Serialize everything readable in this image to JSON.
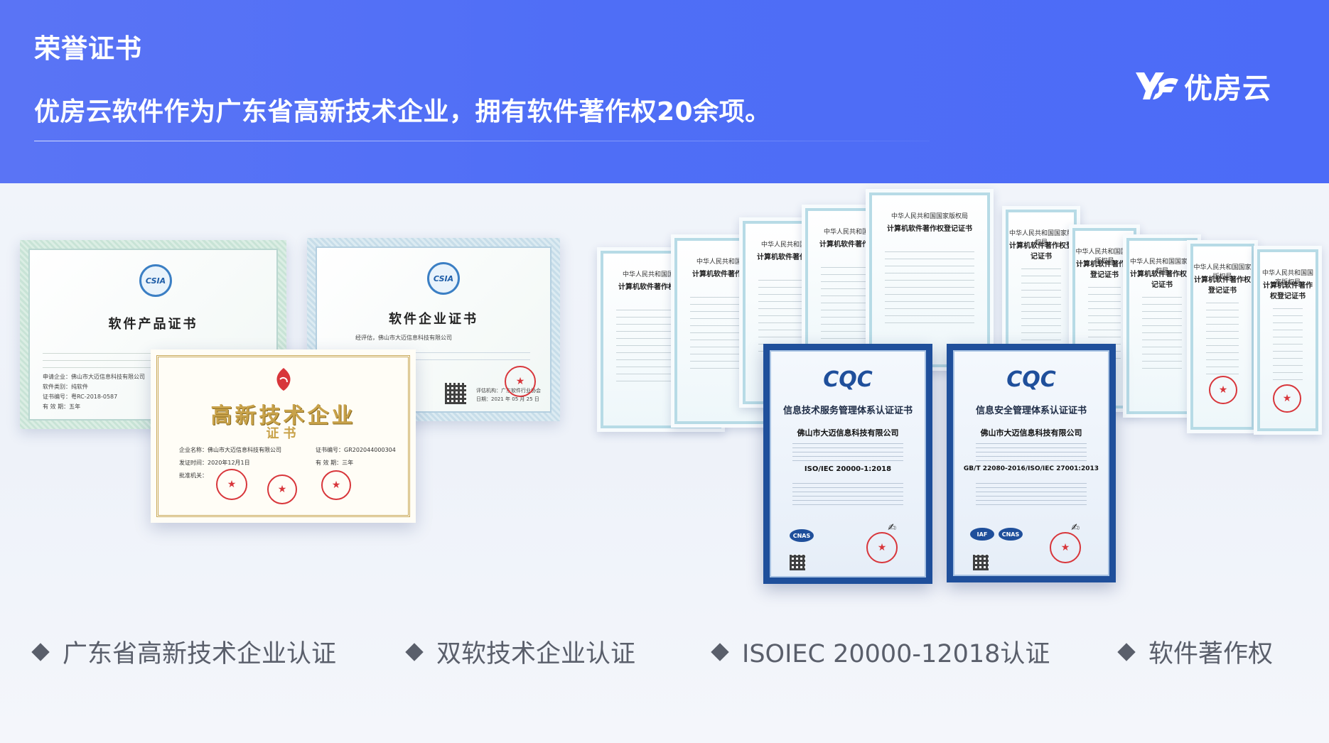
{
  "header": {
    "title": "荣誉证书",
    "subtitle": "优房云软件作为广东省高新技术企业，拥有软件著作权20余项。",
    "logo_text": "优房云",
    "logo_mark": "YF-logo-icon",
    "bg_color": "#4f6ef6"
  },
  "certificates": {
    "software_product": {
      "title": "软件产品证书",
      "badge": "CSIA",
      "company_line": "申请企业：佛山市大迈信息科技有限公司",
      "category_line": "软件类别：纯软件",
      "cert_no_line": "证书编号：粤RC-2018-0587",
      "validity_line": "有 效 期：五年"
    },
    "software_enterprise": {
      "title": "软件企业证书",
      "badge": "CSIA",
      "body_line": "经评估，佛山市大迈信息科技有限公司",
      "issuer_line": "评估机构：广东软件行业协会",
      "date_line": "日期：2021 年 05 月 25 日"
    },
    "gaoxin": {
      "title": "高新技术企业",
      "subtitle": "证书",
      "company_label": "企业名称：",
      "company_value": "佛山市大迈信息科技有限公司",
      "cert_no_label": "证书编号：",
      "cert_no_value": "GR202044000304",
      "date_label": "发证时间：",
      "date_value": "2020年12月1日",
      "validity_label": "有 效 期：",
      "validity_value": "三年",
      "authority_label": "批准机关："
    },
    "copyrights": {
      "head": "中华人民共和国国家版权局",
      "title": "计算机软件著作权登记证书",
      "count": 9
    },
    "iso_service": {
      "brand": "CQC",
      "title": "信息技术服务管理体系认证证书",
      "company": "佛山市大迈信息科技有限公司",
      "standard": "ISO/IEC 20000-1:2018",
      "accreditations": [
        "CNAS"
      ]
    },
    "iso_security": {
      "brand": "CQC",
      "title": "信息安全管理体系认证证书",
      "company": "佛山市大迈信息科技有限公司",
      "standard": "GB/T 22080-2016/ISO/IEC 27001:2013",
      "accreditations": [
        "IAF",
        "CNAS"
      ]
    }
  },
  "features": [
    {
      "label": "广东省高新技术企业认证",
      "icon": "diamond-bullet-icon"
    },
    {
      "label": "双软技术企业认证",
      "icon": "diamond-bullet-icon"
    },
    {
      "label": "ISOIEC 20000-12018认证",
      "icon": "diamond-bullet-icon"
    },
    {
      "label": "软件著作权",
      "icon": "diamond-bullet-icon"
    }
  ]
}
